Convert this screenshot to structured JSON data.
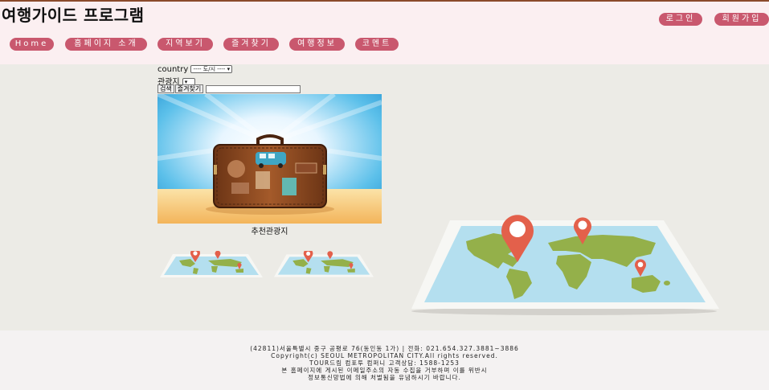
{
  "header": {
    "title": "여행가이드 프로그램",
    "nav": [
      {
        "label": "Home"
      },
      {
        "label": "홈페이지 소개"
      },
      {
        "label": "지역보기"
      },
      {
        "label": "즐겨찾기"
      },
      {
        "label": "여행정보"
      },
      {
        "label": "코멘트"
      }
    ],
    "auth": {
      "login": "로그인",
      "signup": "회원가입"
    }
  },
  "search": {
    "country_label": "country",
    "region_select_value": "---- 도/시 ----",
    "spot_label": "관광지",
    "search_button": "검색",
    "favorite_button": "즐겨찾기",
    "query_value": ""
  },
  "feature": {
    "caption": "추천관광지",
    "icons": [
      "suitcase-photo",
      "world-map-pins-illustration"
    ]
  },
  "footer": {
    "lines": [
      "(42811)서울특별시 중구 공평로 76(동인동 1가) | 전화: 021.654.327.3881~3886",
      "Copyright(c) SEOUL METROPOLITAN CITY.All rights reserved.",
      "TOUR드림 컴포투 컴퍼니 고객상담: 1588-1253",
      "본 홈페이지에 게시된 이메일주소의 자동 수집을 거부하며 이를 위반시",
      "정보통신망법에 의해 처벌됨을 유념하시기 바랍니다."
    ]
  },
  "colors": {
    "header_bg": "#fbeff1",
    "nav_pill": "#c9586e",
    "main_bg": "#ecebe6",
    "map_ocean": "#b4dfef",
    "map_land": "#94b04a",
    "pin": "#e3604b"
  }
}
